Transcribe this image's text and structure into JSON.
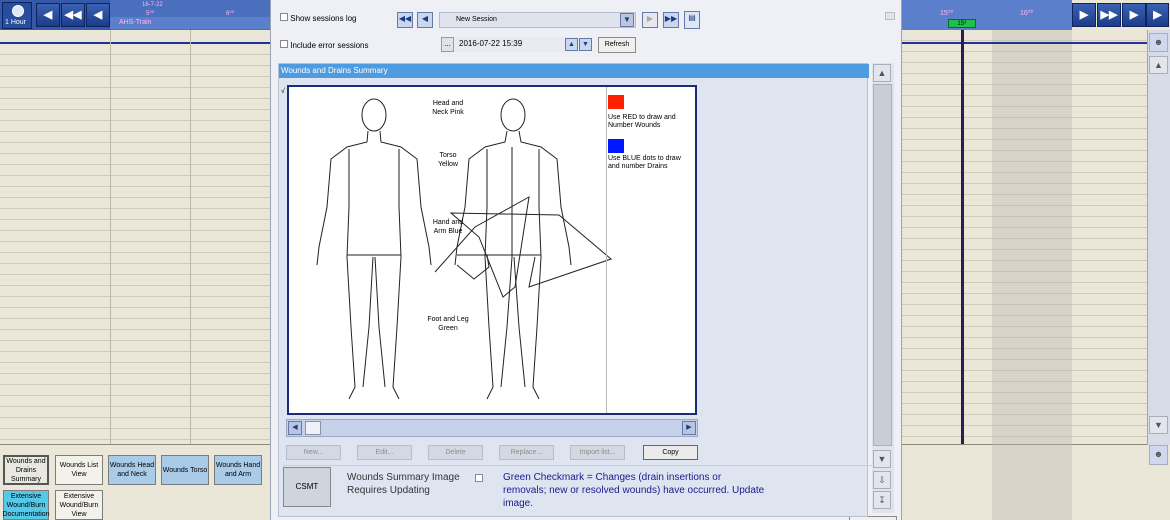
{
  "left_timeline": {
    "zoom_label": "1 Hour",
    "date_top": "16-7-22",
    "time_a": "5⁰⁰",
    "time_b": "6⁰⁰",
    "patient_label": "AHS-Train"
  },
  "right_timeline": {
    "time_a": "15⁰⁰",
    "time_b": "16⁰⁰",
    "current_time": "15⁹"
  },
  "session": {
    "show_log_label": "Show sessions log",
    "include_errors_label": "Include error sessions",
    "session_name": "New Session",
    "datetime": "2016-07-22  15:39",
    "refresh_label": "Refresh",
    "dots_label": "..."
  },
  "panel": {
    "title": "Wounds and Drains Summary",
    "checkmark": "√"
  },
  "diagram": {
    "head_neck": "Head and Neck Pink",
    "torso": "Torso Yellow",
    "hand_arm": "Hand and Arm Blue",
    "foot_leg": "Foot and Leg Green",
    "red_instruction": "Use RED to draw and Number Wounds",
    "blue_instruction": "Use BLUE dots to draw and number Drains",
    "red_color": "#ff2000",
    "blue_color": "#0018ff"
  },
  "actions": {
    "new": "New...",
    "edit": "Edit...",
    "delete": "Delete",
    "replace": "Replace...",
    "import": "Import list...",
    "copy": "Copy"
  },
  "footer": {
    "csmt": "CSMT",
    "summary_line1": "Wounds Summary Image",
    "summary_line2": "Requires Updating",
    "legend": "Green Checkmark  = Changes (drain insertions or removals; new or resolved wounds) have occurred. Update image."
  },
  "tiles": [
    {
      "label": "Wounds and Drains Summary"
    },
    {
      "label": "Wounds List View"
    },
    {
      "label": "Wounds Head and Neck"
    },
    {
      "label": "Wounds Torso"
    },
    {
      "label": "Wounds Hand and Arm"
    },
    {
      "label": "Extensive Wound/Burn Documentation"
    },
    {
      "label": "Extensive Wound/Burn View"
    }
  ]
}
